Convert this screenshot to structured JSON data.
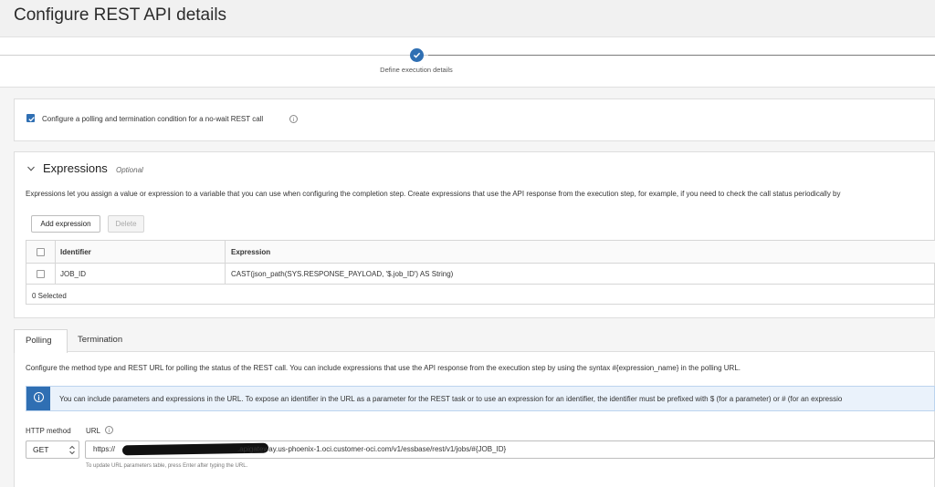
{
  "page": {
    "title": "Configure REST API details"
  },
  "stepper": {
    "step_label": "Define execution details"
  },
  "polling_option": {
    "checked": true,
    "label": "Configure a polling and termination condition for a no-wait REST call"
  },
  "expressions": {
    "title": "Expressions",
    "optional_label": "Optional",
    "description": "Expressions let you assign a value or expression to a variable that you can use when configuring the completion step. Create expressions that use the API response from the execution step, for example, if you need to check the call status periodically by",
    "add_button": "Add expression",
    "delete_button": "Delete",
    "table": {
      "columns": [
        "Identifier",
        "Expression"
      ],
      "rows": [
        {
          "identifier": "JOB_ID",
          "expression": "CAST(json_path(SYS.RESPONSE_PAYLOAD, '$.job_ID') AS String)"
        }
      ],
      "footer": "0 Selected"
    }
  },
  "tabs": [
    {
      "label": "Polling",
      "active": true
    },
    {
      "label": "Termination",
      "active": false
    }
  ],
  "polling": {
    "description": "Configure the method type and REST URL for polling the status of the REST call. You can include expressions that use the API response from the execution step by using the syntax #{expression_name} in the polling URL.",
    "banner": "You can include parameters and expressions in the URL. To expose an identifier in the URL as a parameter for the REST task or to use an expression for an identifier, the identifier must be prefixed with $ (for a parameter) or # (for an expressio",
    "http_method_label": "HTTP method",
    "http_method_value": "GET",
    "url_label": "URL",
    "url_prefix": "https://",
    "url_suffix": ".apigateway.us-phoenix-1.oci.customer-oci.com/v1/essbase/rest/v1/jobs/#{JOB_ID}",
    "url_hint": "To update URL parameters table, press Enter after typing the URL."
  },
  "colors": {
    "accent": "#2f6fb3",
    "banner_bg": "#eaf2fb"
  }
}
